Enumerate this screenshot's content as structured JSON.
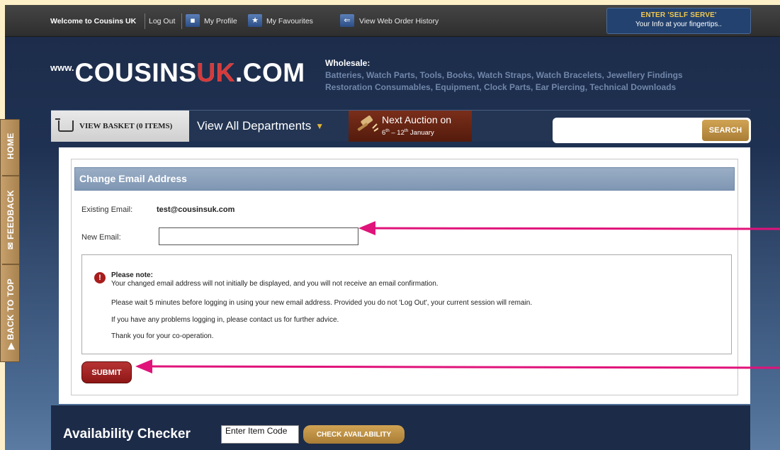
{
  "topbar": {
    "welcome": "Welcome to Cousins UK",
    "logout": "Log Out",
    "profile": "My Profile",
    "favourites": "My Favourites",
    "orders": "View Web Order History",
    "self_serve_title": "ENTER 'SELF SERVE'",
    "self_serve_sub": "Your Info at your fingertips.."
  },
  "header": {
    "logo_www": "www.",
    "logo_cousins": "COUSINS",
    "logo_uk": "UK",
    "logo_com": ".COM",
    "wholesale_title": "Wholesale:",
    "wholesale_line1": "Batteries, Watch Parts, Tools, Books, Watch Straps, Watch Bracelets, Jewellery Findings",
    "wholesale_line2": "Restoration Consumables, Equipment, Clock Parts, Ear Piercing, Technical Downloads"
  },
  "nav": {
    "basket": "VIEW BASKET (0 ITEMS)",
    "departments": "View All Departments",
    "auction_title": "Next Auction on",
    "auction_start": "6",
    "auction_start_sup": "th",
    "auction_dash": " – ",
    "auction_end": "12",
    "auction_end_sup": "th",
    "auction_month": " January",
    "search_button": "SEARCH",
    "search_placeholder": ""
  },
  "sidetab": {
    "home": "HOME",
    "feedback": "FEEDBACK",
    "back_to_top": "BACK TO TOP"
  },
  "form": {
    "heading": "Change Email Address",
    "existing_label": "Existing Email:",
    "existing_value": "test@cousinsuk.com",
    "new_label": "New Email:",
    "new_value": "",
    "note_title": "Please note:",
    "note_line1": "Your changed email address will not initially be displayed, and you will not receive an email confirmation.",
    "note_line2": "Please wait 5 minutes before logging in using your new email address. Provided you do not 'Log Out', your current session will remain.",
    "note_line3": "If you have any problems logging in, please contact us for further advice.",
    "note_line4": "Thank you for your co-operation.",
    "submit": "SUBMIT"
  },
  "availability": {
    "title": "Availability Checker",
    "input_value": "Enter Item Code",
    "button": "CHECK AVAILABILITY"
  },
  "colors": {
    "accent_gold": "#c8994a",
    "submit_red": "#a32020",
    "annotation_arrow": "#e0137a"
  },
  "icons": [
    "profile-icon",
    "star-icon",
    "history-icon",
    "cart-icon",
    "dropdown-arrow-icon",
    "gavel-icon",
    "warning-icon",
    "mail-icon",
    "arrow-up-icon"
  ]
}
